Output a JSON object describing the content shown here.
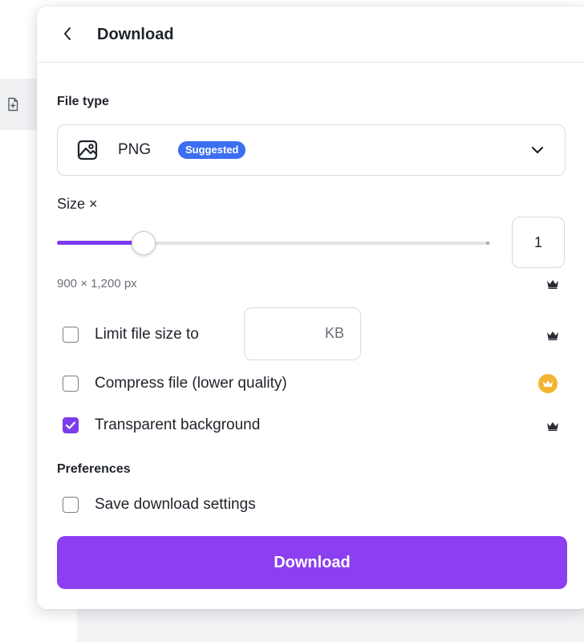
{
  "header": {
    "title": "Download"
  },
  "file_type": {
    "section_label": "File type",
    "selected": "PNG",
    "badge": "Suggested"
  },
  "size": {
    "label": "Size ×",
    "scale_value": "1",
    "slider_fraction": 0.2,
    "dimensions": "900 × 1,200 px"
  },
  "options": {
    "limit_size": {
      "label": "Limit file size to",
      "checked": false,
      "unit": "KB",
      "value": ""
    },
    "compress": {
      "label": "Compress file (lower quality)",
      "checked": false
    },
    "transparent": {
      "label": "Transparent background",
      "checked": true
    }
  },
  "preferences": {
    "section_label": "Preferences",
    "save_settings": {
      "label": "Save download settings",
      "checked": false
    }
  },
  "actions": {
    "download_label": "Download"
  },
  "colors": {
    "accent": "#8b3ff0",
    "badge": "#3b6ef0",
    "pro_crown": "#f2b431"
  },
  "icons": {
    "back": "chevron-left-icon",
    "file_type": "image-icon",
    "dropdown": "chevron-down-icon",
    "pro": "crown-icon"
  }
}
